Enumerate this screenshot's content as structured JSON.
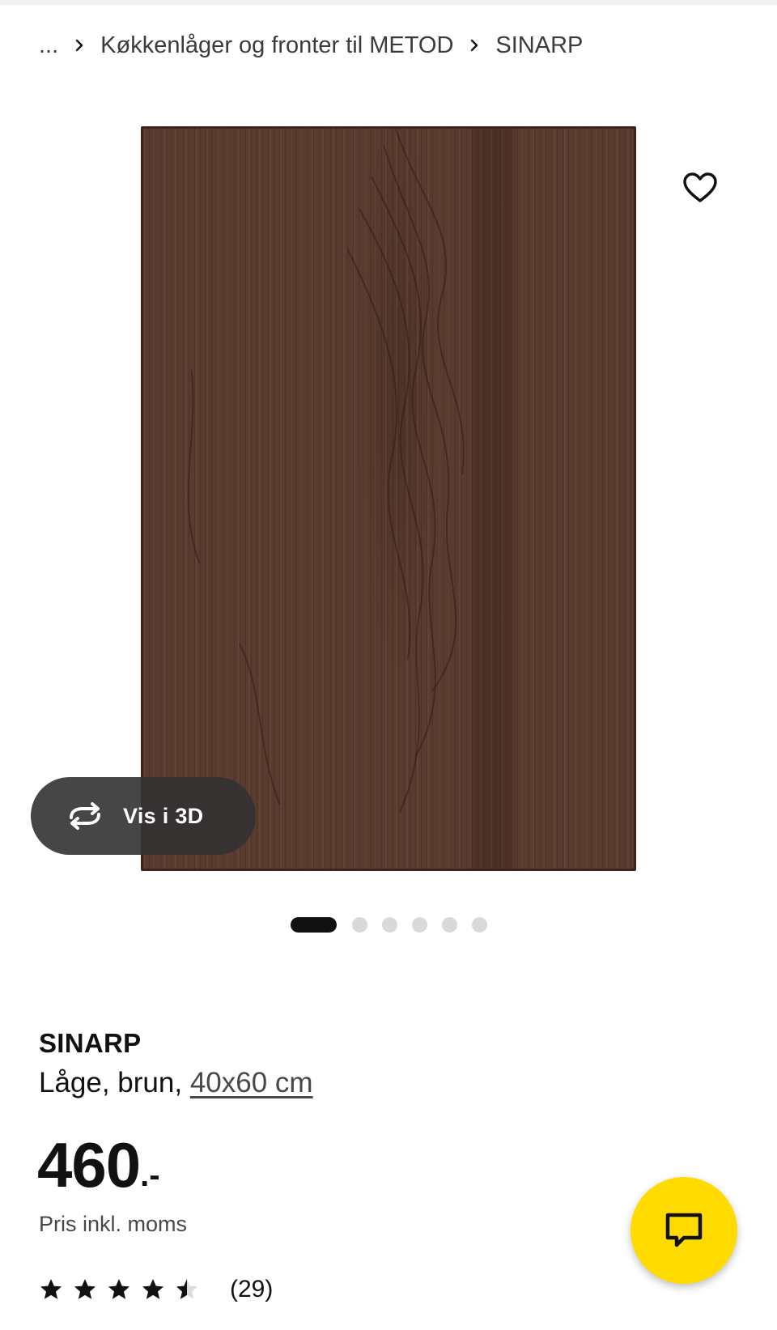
{
  "breadcrumb": {
    "items": [
      {
        "label": "..."
      },
      {
        "label": "Køkkenlåger og fronter til METOD"
      },
      {
        "label": "SINARP"
      }
    ]
  },
  "gallery": {
    "image_icon": "wood-door-image",
    "favorite_icon": "heart-icon",
    "view_3d_icon": "rotate-3d-icon",
    "view_3d_label": "Vis i 3D",
    "dot_count": 6,
    "active_index": 0
  },
  "product": {
    "name": "SINARP",
    "description_prefix": "Låge, brun,",
    "size": "40x60 cm",
    "price_integer": "460",
    "price_suffix": ".-",
    "price_note": "Pris inkl. moms",
    "rating": 4.5,
    "rating_max": 5,
    "review_count": "(29)"
  },
  "chat": {
    "icon": "chat-icon",
    "color": "#ffdb00"
  },
  "colors": {
    "brand_yellow": "#ffdb00",
    "text_primary": "#111111",
    "text_secondary": "#484848",
    "wood_brown": "#5a3b2f"
  }
}
